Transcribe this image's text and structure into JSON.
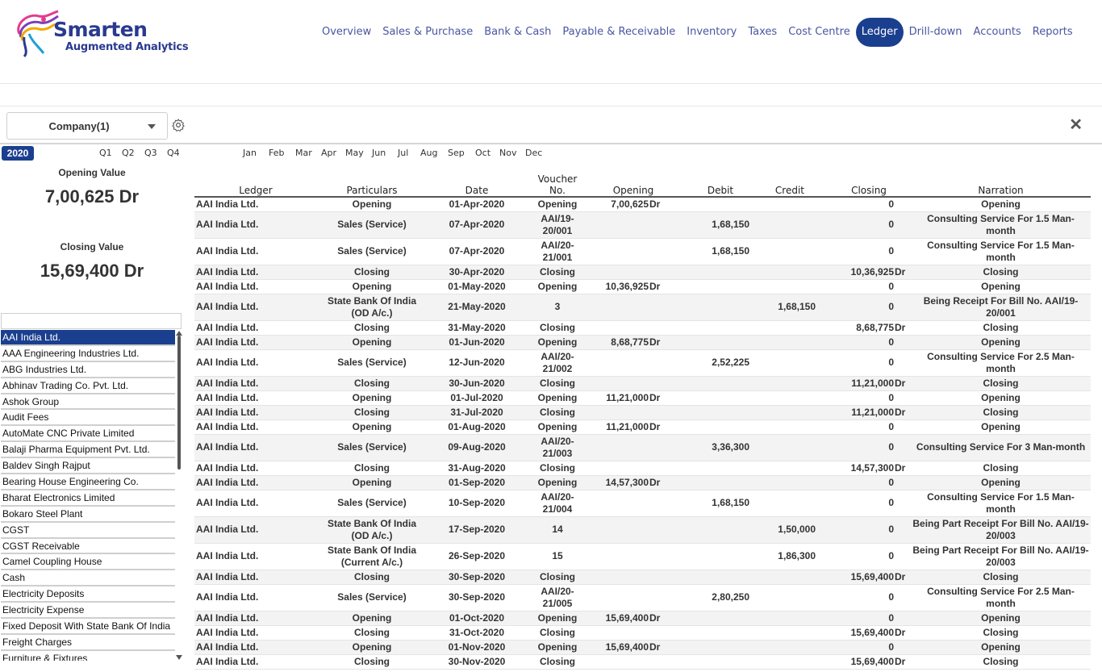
{
  "brand": {
    "title": "Smarten",
    "subtitle": "Augmented Analytics"
  },
  "nav": [
    {
      "label": "Overview",
      "active": false
    },
    {
      "label": "Sales & Purchase",
      "active": false
    },
    {
      "label": "Bank & Cash",
      "active": false
    },
    {
      "label": "Payable & Receivable",
      "active": false
    },
    {
      "label": "Inventory",
      "active": false
    },
    {
      "label": "Taxes",
      "active": false
    },
    {
      "label": "Cost Centre",
      "active": false
    },
    {
      "label": "Ledger",
      "active": true
    },
    {
      "label": "Drill-down",
      "active": false
    },
    {
      "label": "Accounts",
      "active": false
    },
    {
      "label": "Reports",
      "active": false
    }
  ],
  "filters": {
    "company_label": "Company(1)",
    "close": "✕"
  },
  "period": {
    "year": "2020",
    "quarters": [
      "Q1",
      "Q2",
      "Q3",
      "Q4"
    ],
    "months": [
      "Jan",
      "Feb",
      "Mar",
      "Apr",
      "May",
      "Jun",
      "Jul",
      "Aug",
      "Sep",
      "Oct",
      "Nov",
      "Dec"
    ]
  },
  "kpis": {
    "opening_label": "Opening Value",
    "opening_value": "7,00,625 Dr",
    "closing_label": "Closing Value",
    "closing_value": "15,69,400 Dr"
  },
  "ledger_list": {
    "search_value": "",
    "items": [
      "AAI India Ltd.",
      "AAA Engineering Industries Ltd.",
      "ABG Industries Ltd.",
      "Abhinav Trading Co. Pvt. Ltd.",
      "Ashok Group",
      "Audit Fees",
      "AutoMate CNC Private Limited",
      "Balaji Pharma Equipment Pvt. Ltd.",
      "Baldev Singh Rajput",
      "Bearing House Engineering Co.",
      "Bharat Electronics Limited",
      "Bokaro Steel Plant",
      "CGST",
      "CGST Receivable",
      "Camel Coupling House",
      "Cash",
      "Electricity Deposits",
      "Electricity Expense",
      "Fixed Deposit With State Bank Of India",
      "Freight Charges",
      "Furniture & Fixtures"
    ],
    "selected_index": 0
  },
  "table": {
    "headers": [
      "Ledger",
      "Particulars",
      "Date",
      "Voucher No.",
      "Opening",
      "Debit",
      "Credit",
      "Closing",
      "Narration"
    ],
    "rows": [
      {
        "ledger": "AAI India Ltd.",
        "particulars": "Opening",
        "date": "01-Apr-2020",
        "voucher": "Opening",
        "opening": "7,00,625",
        "opening_dr": "Dr",
        "debit": "",
        "credit": "",
        "closing": "0",
        "closing_dr": "",
        "narration": "Opening",
        "tall": false
      },
      {
        "ledger": "AAI India Ltd.",
        "particulars": "Sales (Service)",
        "date": "07-Apr-2020",
        "voucher": "AAI/19-20/001",
        "opening": "",
        "opening_dr": "",
        "debit": "1,68,150",
        "credit": "",
        "closing": "0",
        "closing_dr": "",
        "narration": "Consulting Service For 1.5 Man-month",
        "tall": true
      },
      {
        "ledger": "AAI India Ltd.",
        "particulars": "Sales (Service)",
        "date": "07-Apr-2020",
        "voucher": "AAI/20-21/001",
        "opening": "",
        "opening_dr": "",
        "debit": "1,68,150",
        "credit": "",
        "closing": "0",
        "closing_dr": "",
        "narration": "Consulting Service For 1.5 Man-month",
        "tall": true
      },
      {
        "ledger": "AAI India Ltd.",
        "particulars": "Closing",
        "date": "30-Apr-2020",
        "voucher": "Closing",
        "opening": "",
        "opening_dr": "",
        "debit": "",
        "credit": "",
        "closing": "10,36,925",
        "closing_dr": "Dr",
        "narration": "Closing",
        "tall": false
      },
      {
        "ledger": "AAI India Ltd.",
        "particulars": "Opening",
        "date": "01-May-2020",
        "voucher": "Opening",
        "opening": "10,36,925",
        "opening_dr": "Dr",
        "debit": "",
        "credit": "",
        "closing": "0",
        "closing_dr": "",
        "narration": "Opening",
        "tall": false
      },
      {
        "ledger": "AAI India Ltd.",
        "particulars": "State Bank Of India (OD A/c.)",
        "date": "21-May-2020",
        "voucher": "3",
        "opening": "",
        "opening_dr": "",
        "debit": "",
        "credit": "1,68,150",
        "closing": "0",
        "closing_dr": "",
        "narration": "Being Receipt For Bill No. AAI/19-20/001",
        "tall": true
      },
      {
        "ledger": "AAI India Ltd.",
        "particulars": "Closing",
        "date": "31-May-2020",
        "voucher": "Closing",
        "opening": "",
        "opening_dr": "",
        "debit": "",
        "credit": "",
        "closing": "8,68,775",
        "closing_dr": "Dr",
        "narration": "Closing",
        "tall": false
      },
      {
        "ledger": "AAI India Ltd.",
        "particulars": "Opening",
        "date": "01-Jun-2020",
        "voucher": "Opening",
        "opening": "8,68,775",
        "opening_dr": "Dr",
        "debit": "",
        "credit": "",
        "closing": "0",
        "closing_dr": "",
        "narration": "Opening",
        "tall": false
      },
      {
        "ledger": "AAI India Ltd.",
        "particulars": "Sales (Service)",
        "date": "12-Jun-2020",
        "voucher": "AAI/20-21/002",
        "opening": "",
        "opening_dr": "",
        "debit": "2,52,225",
        "credit": "",
        "closing": "0",
        "closing_dr": "",
        "narration": "Consulting Service For 2.5 Man-month",
        "tall": true
      },
      {
        "ledger": "AAI India Ltd.",
        "particulars": "Closing",
        "date": "30-Jun-2020",
        "voucher": "Closing",
        "opening": "",
        "opening_dr": "",
        "debit": "",
        "credit": "",
        "closing": "11,21,000",
        "closing_dr": "Dr",
        "narration": "Closing",
        "tall": false
      },
      {
        "ledger": "AAI India Ltd.",
        "particulars": "Opening",
        "date": "01-Jul-2020",
        "voucher": "Opening",
        "opening": "11,21,000",
        "opening_dr": "Dr",
        "debit": "",
        "credit": "",
        "closing": "0",
        "closing_dr": "",
        "narration": "Opening",
        "tall": false
      },
      {
        "ledger": "AAI India Ltd.",
        "particulars": "Closing",
        "date": "31-Jul-2020",
        "voucher": "Closing",
        "opening": "",
        "opening_dr": "",
        "debit": "",
        "credit": "",
        "closing": "11,21,000",
        "closing_dr": "Dr",
        "narration": "Closing",
        "tall": false
      },
      {
        "ledger": "AAI India Ltd.",
        "particulars": "Opening",
        "date": "01-Aug-2020",
        "voucher": "Opening",
        "opening": "11,21,000",
        "opening_dr": "Dr",
        "debit": "",
        "credit": "",
        "closing": "0",
        "closing_dr": "",
        "narration": "Opening",
        "tall": false
      },
      {
        "ledger": "AAI India Ltd.",
        "particulars": "Sales (Service)",
        "date": "09-Aug-2020",
        "voucher": "AAI/20-21/003",
        "opening": "",
        "opening_dr": "",
        "debit": "3,36,300",
        "credit": "",
        "closing": "0",
        "closing_dr": "",
        "narration": "Consulting Service For 3 Man-month",
        "tall": true
      },
      {
        "ledger": "AAI India Ltd.",
        "particulars": "Closing",
        "date": "31-Aug-2020",
        "voucher": "Closing",
        "opening": "",
        "opening_dr": "",
        "debit": "",
        "credit": "",
        "closing": "14,57,300",
        "closing_dr": "Dr",
        "narration": "Closing",
        "tall": false
      },
      {
        "ledger": "AAI India Ltd.",
        "particulars": "Opening",
        "date": "01-Sep-2020",
        "voucher": "Opening",
        "opening": "14,57,300",
        "opening_dr": "Dr",
        "debit": "",
        "credit": "",
        "closing": "0",
        "closing_dr": "",
        "narration": "Opening",
        "tall": false
      },
      {
        "ledger": "AAI India Ltd.",
        "particulars": "Sales (Service)",
        "date": "10-Sep-2020",
        "voucher": "AAI/20-21/004",
        "opening": "",
        "opening_dr": "",
        "debit": "1,68,150",
        "credit": "",
        "closing": "0",
        "closing_dr": "",
        "narration": "Consulting Service For 1.5 Man-month",
        "tall": true
      },
      {
        "ledger": "AAI India Ltd.",
        "particulars": "State Bank Of India (OD A/c.)",
        "date": "17-Sep-2020",
        "voucher": "14",
        "opening": "",
        "opening_dr": "",
        "debit": "",
        "credit": "1,50,000",
        "closing": "0",
        "closing_dr": "",
        "narration": "Being Part Receipt For Bill No. AAI/19-20/003",
        "tall": true
      },
      {
        "ledger": "AAI India Ltd.",
        "particulars": "State Bank Of India (Current A/c.)",
        "date": "26-Sep-2020",
        "voucher": "15",
        "opening": "",
        "opening_dr": "",
        "debit": "",
        "credit": "1,86,300",
        "closing": "0",
        "closing_dr": "",
        "narration": "Being Part Receipt For Bill No. AAI/19-20/003",
        "tall": true
      },
      {
        "ledger": "AAI India Ltd.",
        "particulars": "Closing",
        "date": "30-Sep-2020",
        "voucher": "Closing",
        "opening": "",
        "opening_dr": "",
        "debit": "",
        "credit": "",
        "closing": "15,69,400",
        "closing_dr": "Dr",
        "narration": "Closing",
        "tall": false
      },
      {
        "ledger": "AAI India Ltd.",
        "particulars": "Sales (Service)",
        "date": "30-Sep-2020",
        "voucher": "AAI/20-21/005",
        "opening": "",
        "opening_dr": "",
        "debit": "2,80,250",
        "credit": "",
        "closing": "0",
        "closing_dr": "",
        "narration": "Consulting Service For 2.5 Man-month",
        "tall": true
      },
      {
        "ledger": "AAI India Ltd.",
        "particulars": "Opening",
        "date": "01-Oct-2020",
        "voucher": "Opening",
        "opening": "15,69,400",
        "opening_dr": "Dr",
        "debit": "",
        "credit": "",
        "closing": "0",
        "closing_dr": "",
        "narration": "Opening",
        "tall": false
      },
      {
        "ledger": "AAI India Ltd.",
        "particulars": "Closing",
        "date": "31-Oct-2020",
        "voucher": "Closing",
        "opening": "",
        "opening_dr": "",
        "debit": "",
        "credit": "",
        "closing": "15,69,400",
        "closing_dr": "Dr",
        "narration": "Closing",
        "tall": false
      },
      {
        "ledger": "AAI India Ltd.",
        "particulars": "Opening",
        "date": "01-Nov-2020",
        "voucher": "Opening",
        "opening": "15,69,400",
        "opening_dr": "Dr",
        "debit": "",
        "credit": "",
        "closing": "0",
        "closing_dr": "",
        "narration": "Opening",
        "tall": false
      },
      {
        "ledger": "AAI India Ltd.",
        "particulars": "Closing",
        "date": "30-Nov-2020",
        "voucher": "Closing",
        "opening": "",
        "opening_dr": "",
        "debit": "",
        "credit": "",
        "closing": "15,69,400",
        "closing_dr": "Dr",
        "narration": "Closing",
        "tall": false
      }
    ]
  },
  "colors": {
    "accent": "#1b3f8f",
    "nav_text": "#4a55a2",
    "brand": "#2a3a8f"
  }
}
